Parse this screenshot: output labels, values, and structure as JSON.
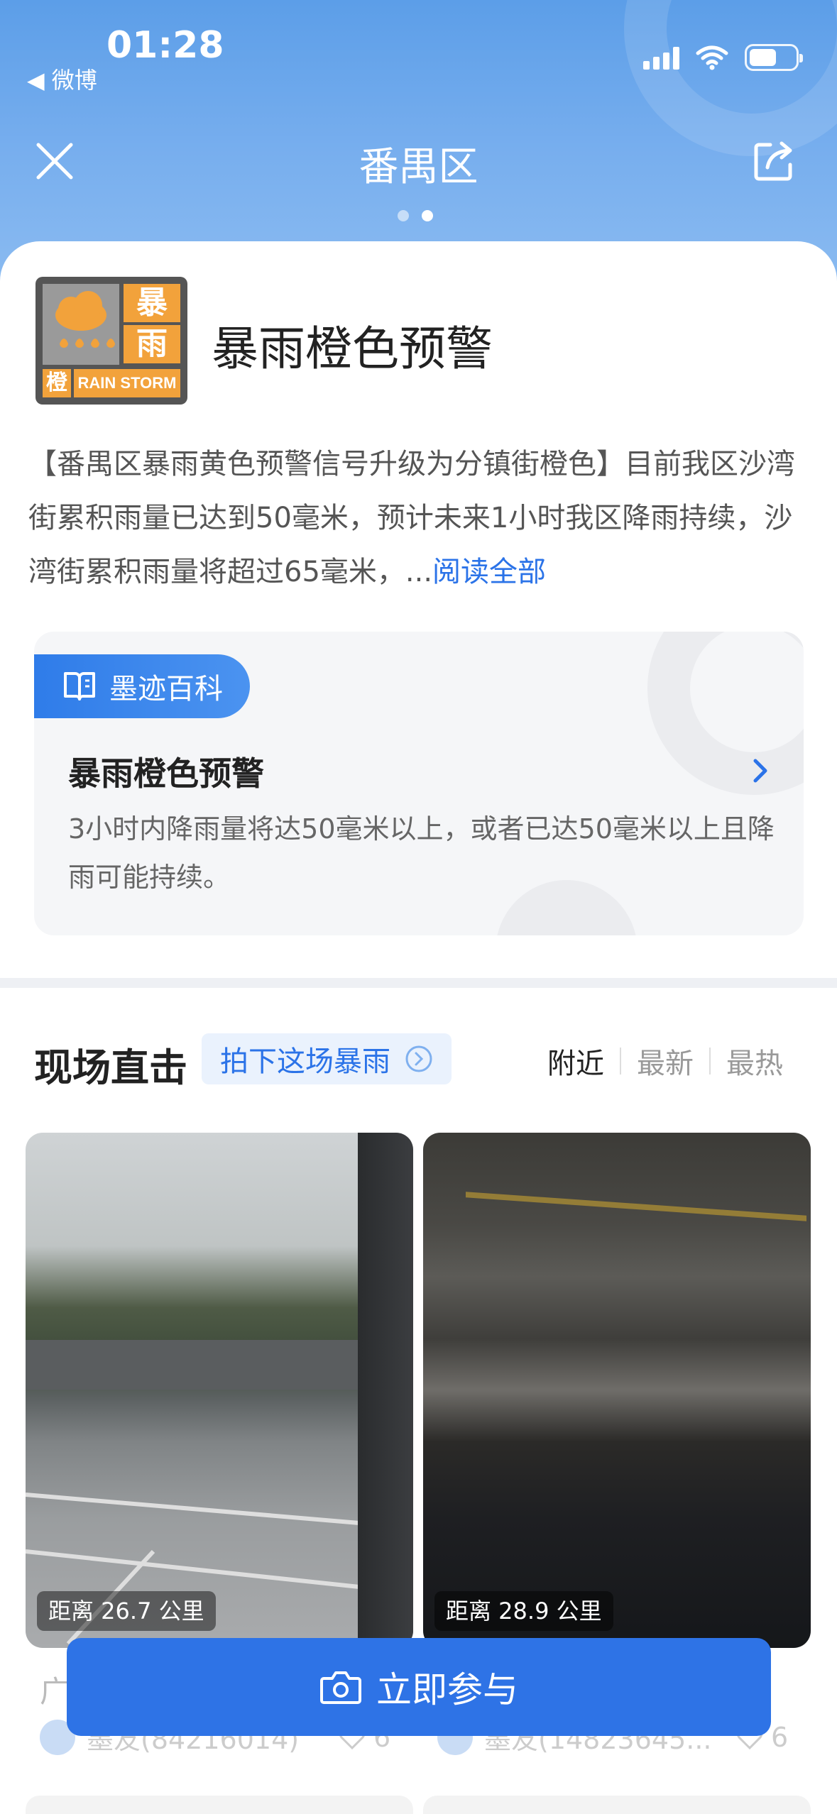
{
  "status_bar": {
    "time": "01:28",
    "back_app": "◀ 微博"
  },
  "nav": {
    "title": "番禺区",
    "page_count": 2,
    "active_page": 2
  },
  "warning": {
    "title": "暴雨橙色预警",
    "icon": {
      "char1": "暴",
      "char2": "雨",
      "color_char": "橙",
      "english": "RAIN STORM",
      "color": "#f2a23b"
    },
    "description": "【番禺区暴雨黄色预警信号升级为分镇街橙色】目前我区沙湾街累积雨量已达到50毫米，预计未来1小时我区降雨持续，沙湾街累积雨量将超过65毫米，...",
    "read_more": "阅读全部"
  },
  "wiki": {
    "tag": "墨迹百科",
    "title": "暴雨橙色预警",
    "text": "3小时内降雨量将达50毫米以上，或者已达50毫米以上且降雨可能持续。"
  },
  "live": {
    "title": "现场直击",
    "pill": "拍下这场暴雨",
    "tabs": [
      "附近",
      "最新",
      "最热"
    ],
    "active_tab": 0,
    "cards": [
      {
        "distance": "距离 26.7 公里",
        "caption_fragment": "广",
        "user": "墨友(84216014)",
        "likes": "6"
      },
      {
        "distance": "距离 28.9 公里",
        "user": "墨友(14823645...",
        "likes": "6"
      }
    ]
  },
  "cta": {
    "label": "立即参与"
  },
  "colors": {
    "accent": "#2e73e6",
    "link": "#2b73e8",
    "header": "#5c9ee8"
  }
}
